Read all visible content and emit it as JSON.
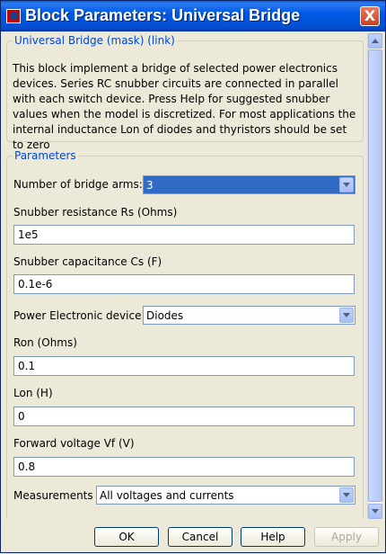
{
  "window": {
    "title": "Block Parameters: Universal Bridge",
    "close_glyph": "X"
  },
  "mask_group": {
    "label": "Universal Bridge (mask) (link)",
    "description": "This block implement a bridge of selected power electronics devices.  Series RC snubber circuits are connected in parallel with each switch device.  Press Help for suggested snubber values when the model is discretized. For most applications the internal inductance Lon of diodes and thyristors should be set to zero"
  },
  "params_group": {
    "label": "Parameters",
    "bridge_arms_label": "Number of bridge arms:",
    "bridge_arms_value": "3",
    "rs_label": "Snubber resistance Rs (Ohms)",
    "rs_value": "1e5",
    "cs_label": "Snubber capacitance Cs (F)",
    "cs_value": "0.1e-6",
    "device_label": "Power Electronic device",
    "device_value": "Diodes",
    "ron_label": "Ron (Ohms)",
    "ron_value": "0.1",
    "lon_label": "Lon (H)",
    "lon_value": "0",
    "vf_label": "Forward voltage Vf (V)",
    "vf_value": "0.8",
    "meas_label": "Measurements",
    "meas_value": "All voltages and currents"
  },
  "buttons": {
    "ok": "OK",
    "cancel": "Cancel",
    "help": "Help",
    "apply": "Apply"
  },
  "colors": {
    "title_bar": "#0058e6",
    "group_label": "#0046d5",
    "selection": "#316ac5",
    "dialog_bg": "#ece9d8"
  }
}
